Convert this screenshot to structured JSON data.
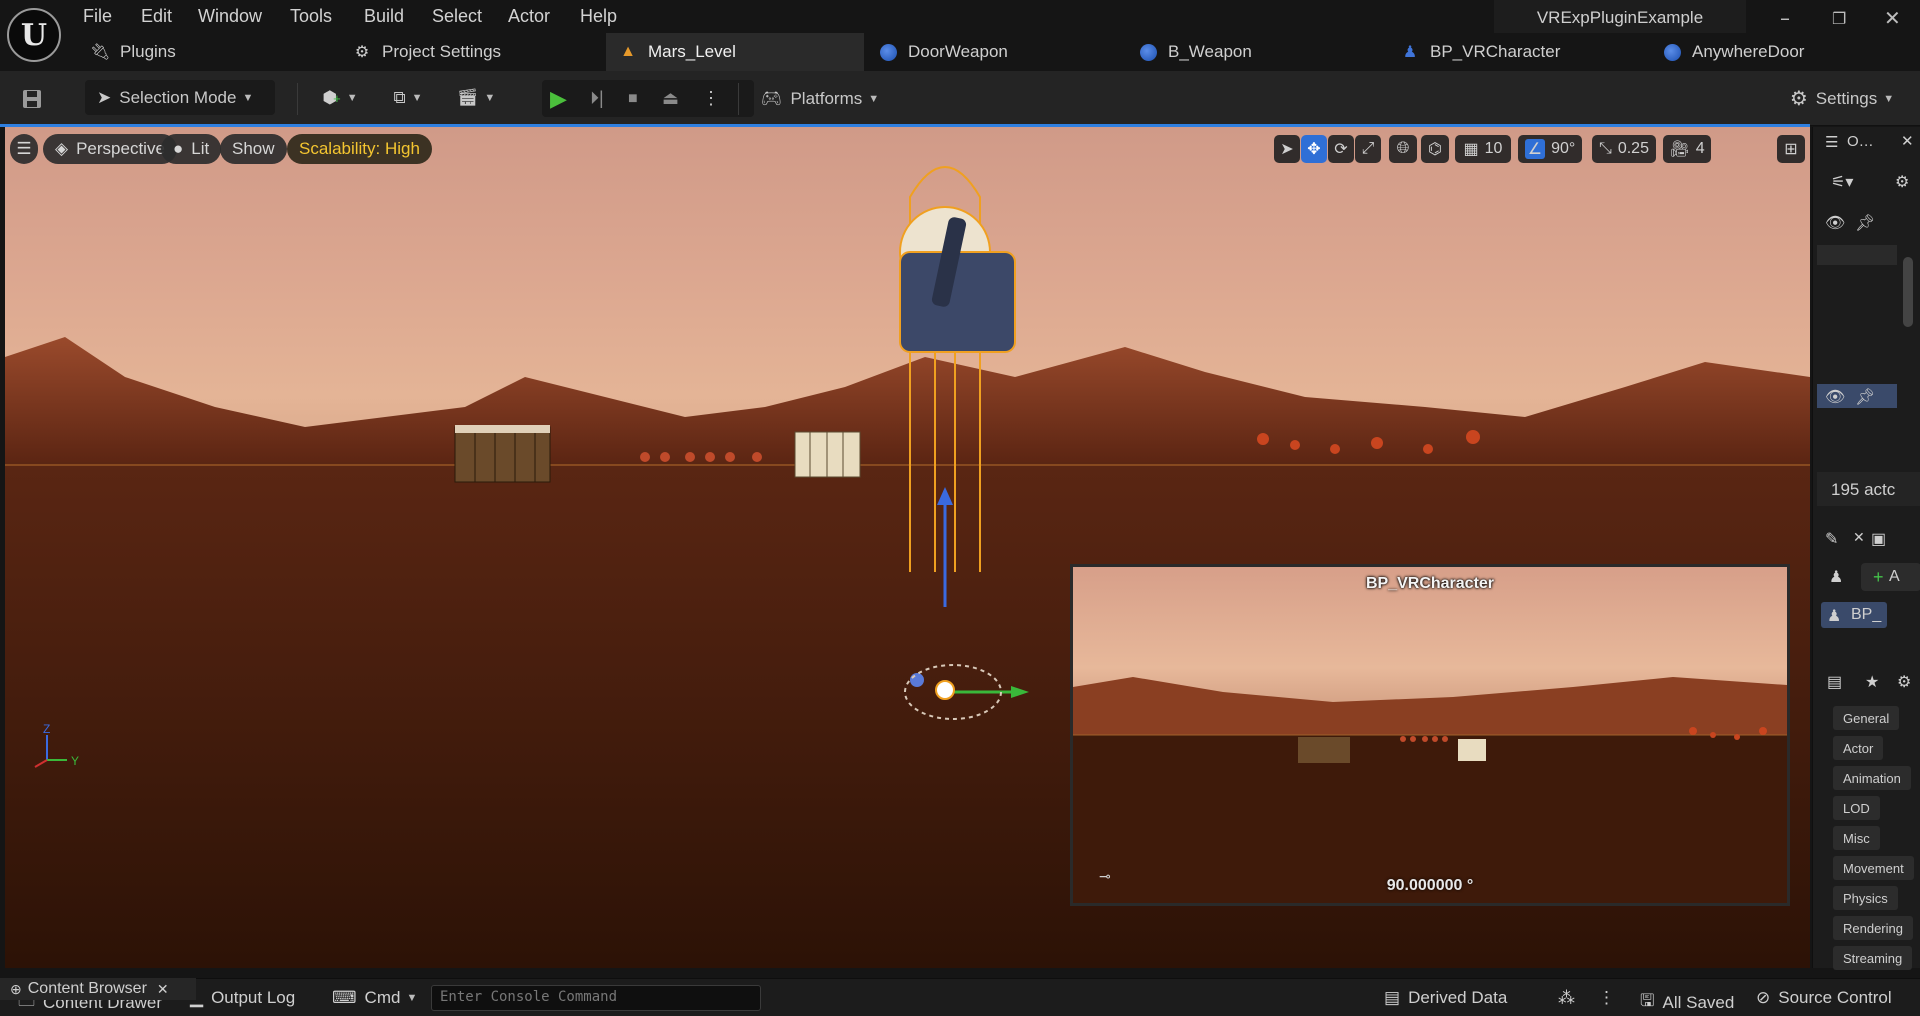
{
  "app": {
    "window_title": "VRExpPluginExample",
    "menu": [
      "File",
      "Edit",
      "Window",
      "Tools",
      "Build",
      "Select",
      "Actor",
      "Help"
    ]
  },
  "tabs": [
    {
      "label": "Plugins",
      "icon": "plugin-icon"
    },
    {
      "label": "Project Settings",
      "icon": "gear-icon"
    },
    {
      "label": "Mars_Level",
      "icon": "level-icon",
      "active": true
    },
    {
      "label": "DoorWeapon",
      "icon": "blueprint-icon"
    },
    {
      "label": "B_Weapon",
      "icon": "blueprint-icon"
    },
    {
      "label": "BP_VRCharacter",
      "icon": "character-icon"
    },
    {
      "label": "AnywhereDoor",
      "icon": "blueprint-icon"
    }
  ],
  "toolbar": {
    "selection_mode": "Selection Mode",
    "platforms": "Platforms",
    "settings": "Settings"
  },
  "viewport": {
    "perspective": "Perspective",
    "lit": "Lit",
    "show": "Show",
    "scalability": "Scalability: High",
    "grid_snap": "10",
    "rotation_snap": "90°",
    "scale_snap": "0.25",
    "camera_speed": "4",
    "pip_label": "BP_VRCharacter",
    "pip_angle": "90.000000 °",
    "colors": {
      "selection": "#f0a020",
      "accent": "#2f7fe0"
    }
  },
  "right_panel": {
    "outliner_tab": "O…",
    "actor_count": "195 actc",
    "add_label": "A",
    "component_label": "BP_",
    "categories": [
      "General",
      "Actor",
      "Animation",
      "LOD",
      "Misc",
      "Movement",
      "Physics",
      "Rendering",
      "Streaming"
    ]
  },
  "status_bar": {
    "content_browser": "Content Browser",
    "content_drawer": "Content Drawer",
    "output_log": "Output Log",
    "cmd": "Cmd",
    "console_placeholder": "Enter Console Command",
    "derived_data": "Derived Data",
    "all_saved": "All Saved",
    "source_control": "Source Control"
  }
}
